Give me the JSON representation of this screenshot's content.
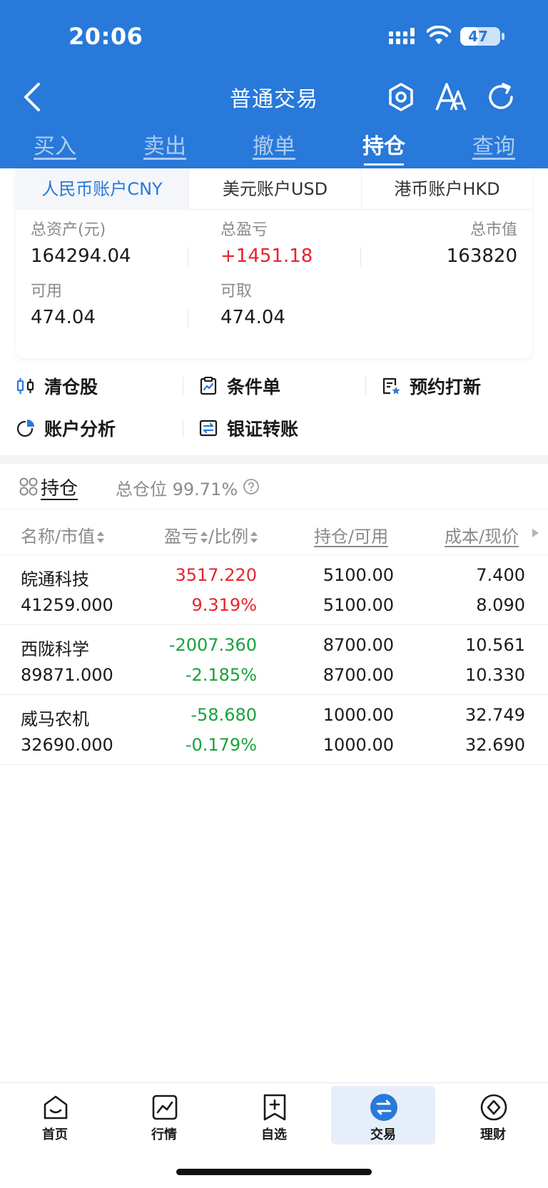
{
  "status_bar": {
    "time": "20:06",
    "battery": "47",
    "battery_level": 0.47
  },
  "nav": {
    "title": "普通交易"
  },
  "main_tabs": [
    {
      "label": "买入"
    },
    {
      "label": "卖出"
    },
    {
      "label": "撤单"
    },
    {
      "label": "持仓",
      "active": true
    },
    {
      "label": "查询"
    }
  ],
  "account_tabs": [
    {
      "label": "人民币账户CNY",
      "active": true
    },
    {
      "label": "美元账户USD"
    },
    {
      "label": "港币账户HKD"
    }
  ],
  "summary": {
    "total_assets_label": "总资产(元)",
    "total_assets": "164294.04",
    "total_pnl_label": "总盈亏",
    "total_pnl": "+1451.18",
    "market_value_label": "总市值",
    "market_value": "163820",
    "available_label": "可用",
    "available": "474.04",
    "withdrawable_label": "可取",
    "withdrawable": "474.04"
  },
  "functions": [
    {
      "label": "清仓股",
      "icon": "candlestick-icon"
    },
    {
      "label": "条件单",
      "icon": "clipboard-chart-icon"
    },
    {
      "label": "预约打新",
      "icon": "document-star-icon"
    },
    {
      "label": "账户分析",
      "icon": "pie-chart-icon"
    },
    {
      "label": "银证转账",
      "icon": "transfer-icon"
    }
  ],
  "positions_header": {
    "title": "持仓",
    "ratio_label": "总仓位",
    "ratio_value": "99.71%"
  },
  "table": {
    "columns": [
      "名称/市值",
      "盈亏",
      "/比例",
      "持仓/可用",
      "成本/现价"
    ],
    "rows": [
      {
        "name": "皖通科技",
        "market_value": "41259.000",
        "pnl": "3517.220",
        "pnl_pct": "9.319%",
        "hold": "5100.00",
        "avail": "5100.00",
        "cost": "7.400",
        "price": "8.090",
        "trend": "up"
      },
      {
        "name": "西陇科学",
        "market_value": "89871.000",
        "pnl": "-2007.360",
        "pnl_pct": "-2.185%",
        "hold": "8700.00",
        "avail": "8700.00",
        "cost": "10.561",
        "price": "10.330",
        "trend": "down"
      },
      {
        "name": "威马农机",
        "market_value": "32690.000",
        "pnl": "-58.680",
        "pnl_pct": "-0.179%",
        "hold": "1000.00",
        "avail": "1000.00",
        "cost": "32.749",
        "price": "32.690",
        "trend": "down"
      }
    ]
  },
  "bottom_nav": [
    {
      "label": "首页",
      "icon": "home-icon"
    },
    {
      "label": "行情",
      "icon": "market-chart-icon"
    },
    {
      "label": "自选",
      "icon": "watchlist-add-icon"
    },
    {
      "label": "交易",
      "icon": "trade-exchange-icon",
      "active": true
    },
    {
      "label": "理财",
      "icon": "wealth-icon"
    }
  ],
  "colors": {
    "brand": "#2879d9",
    "up": "#e8232b",
    "down": "#17a33a"
  }
}
